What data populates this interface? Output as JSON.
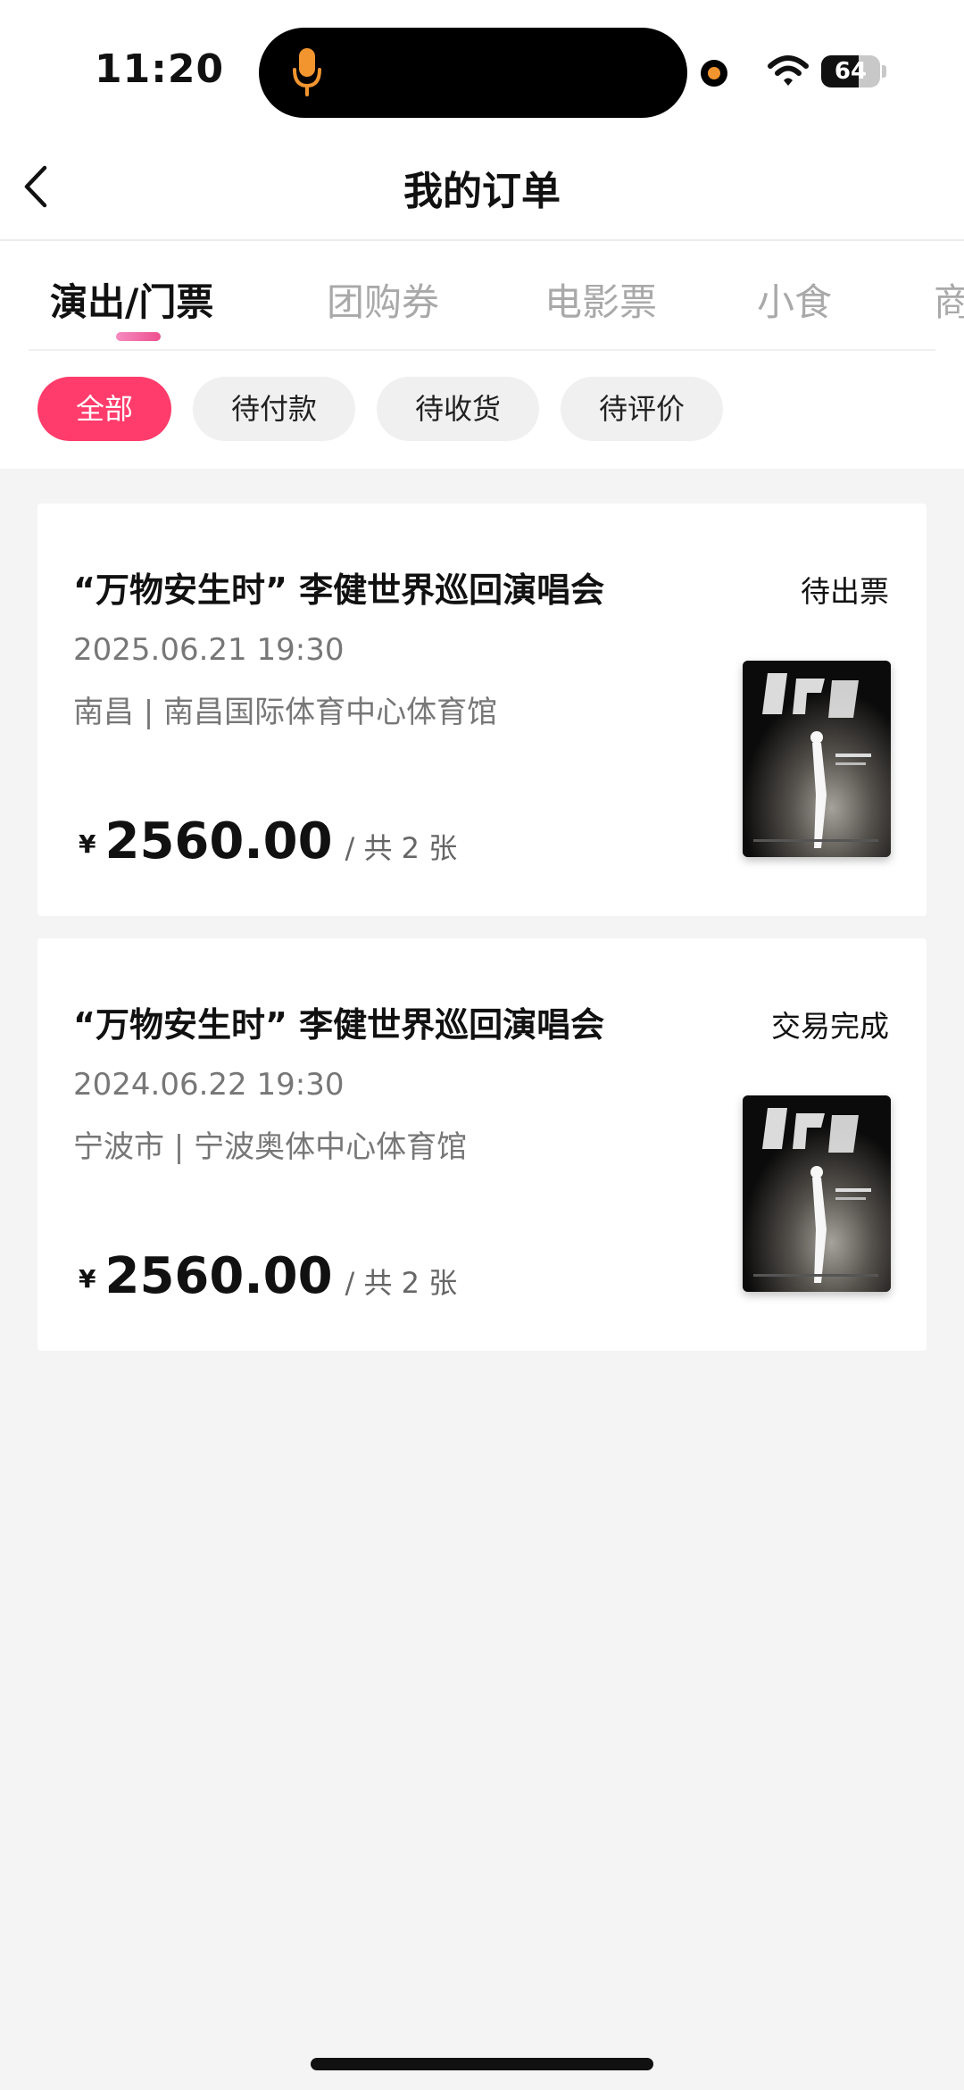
{
  "status_bar": {
    "time": "11:20",
    "battery_level": "64",
    "battery_fraction": 0.64,
    "mic_icon": "microphone-icon",
    "mic_color": "#f2952f",
    "wifi_icon": "wifi-icon"
  },
  "header": {
    "back_icon": "chevron-left-icon",
    "title": "我的订单"
  },
  "tabs": [
    {
      "label": "演出/门票",
      "active": true
    },
    {
      "label": "团购券",
      "active": false
    },
    {
      "label": "电影票",
      "active": false
    },
    {
      "label": "小食",
      "active": false
    },
    {
      "label": "商",
      "active": false
    }
  ],
  "filters": [
    {
      "label": "全部",
      "active": true
    },
    {
      "label": "待付款",
      "active": false
    },
    {
      "label": "待收货",
      "active": false
    },
    {
      "label": "待评价",
      "active": false
    }
  ],
  "orders": [
    {
      "title": "“万物安生时” 李健世界巡回演唱会",
      "status": "待出票",
      "datetime": "2025.06.21 19:30",
      "venue": "南昌 | 南昌国际体育中心体育馆",
      "currency": "¥",
      "price": "2560.00",
      "quantity": "/ 共 2 张"
    },
    {
      "title": "“万物安生时” 李健世界巡回演唱会",
      "status": "交易完成",
      "datetime": "2024.06.22 19:30",
      "venue": "宁波市 | 宁波奥体中心体育馆",
      "currency": "¥",
      "price": "2560.00",
      "quantity": "/ 共 2 张"
    }
  ],
  "colors": {
    "accent": "#ff3c6b",
    "background": "#f4f4f4"
  }
}
